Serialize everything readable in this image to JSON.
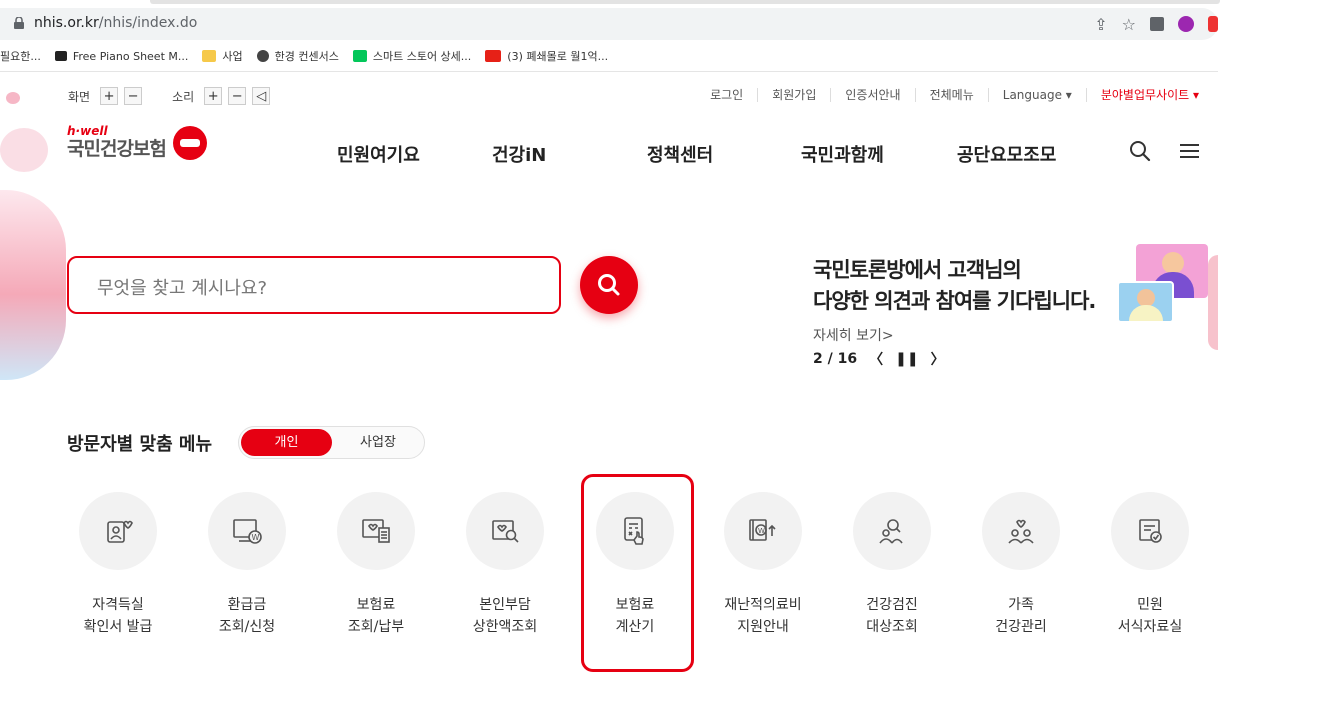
{
  "browser": {
    "url_host": "nhis.or.kr",
    "url_path": "/nhis/index.do",
    "bookmarks": [
      "필요한...",
      "Free Piano Sheet M...",
      "사업",
      "한경 컨센서스",
      "스마트 스토어 상세...",
      "(3) 폐쇄몰로 월1억..."
    ]
  },
  "util": {
    "screen_label": "화면",
    "sound_label": "소리",
    "plus": "+",
    "minus": "−",
    "links": [
      "로그인",
      "회원가입",
      "인증서안내",
      "전체메뉴",
      "Language ▾",
      "분야별업무사이트 ▾"
    ]
  },
  "logo": {
    "small": "h·well",
    "big": "국민건강보험"
  },
  "gnb": [
    "민원여기요",
    "건강iN",
    "정책센터",
    "국민과함께",
    "공단요모조모"
  ],
  "search": {
    "placeholder": "무엇을 찾고 계시나요?"
  },
  "banner": {
    "line1": "국민토론방에서 고객님의",
    "line2": "다양한 의견과 참여를 기다립니다.",
    "more": "자세히 보기>",
    "page": "2 / 16"
  },
  "custom_menu": {
    "title": "방문자별 맞춤 메뉴",
    "toggle_on": "개인",
    "toggle_off": "사업장",
    "items": [
      {
        "l1": "자격득실",
        "l2": "확인서 발급",
        "icon": "id-card-icon"
      },
      {
        "l1": "환급금",
        "l2": "조회/신청",
        "icon": "monitor-won-icon"
      },
      {
        "l1": "보험료",
        "l2": "조회/납부",
        "icon": "receipt-icon"
      },
      {
        "l1": "본인부담",
        "l2": "상한액조회",
        "icon": "search-document-icon"
      },
      {
        "l1": "보험료",
        "l2": "계산기",
        "icon": "calculator-icon"
      },
      {
        "l1": "재난적의료비",
        "l2": "지원안내",
        "icon": "won-support-icon"
      },
      {
        "l1": "건강검진",
        "l2": "대상조회",
        "icon": "people-search-icon"
      },
      {
        "l1": "가족",
        "l2": "건강관리",
        "icon": "family-icon"
      },
      {
        "l1": "민원",
        "l2": "서식자료실",
        "icon": "form-document-icon"
      }
    ]
  },
  "colors": {
    "brand": "#e60012",
    "circle_bg": "#f2f2f2"
  }
}
